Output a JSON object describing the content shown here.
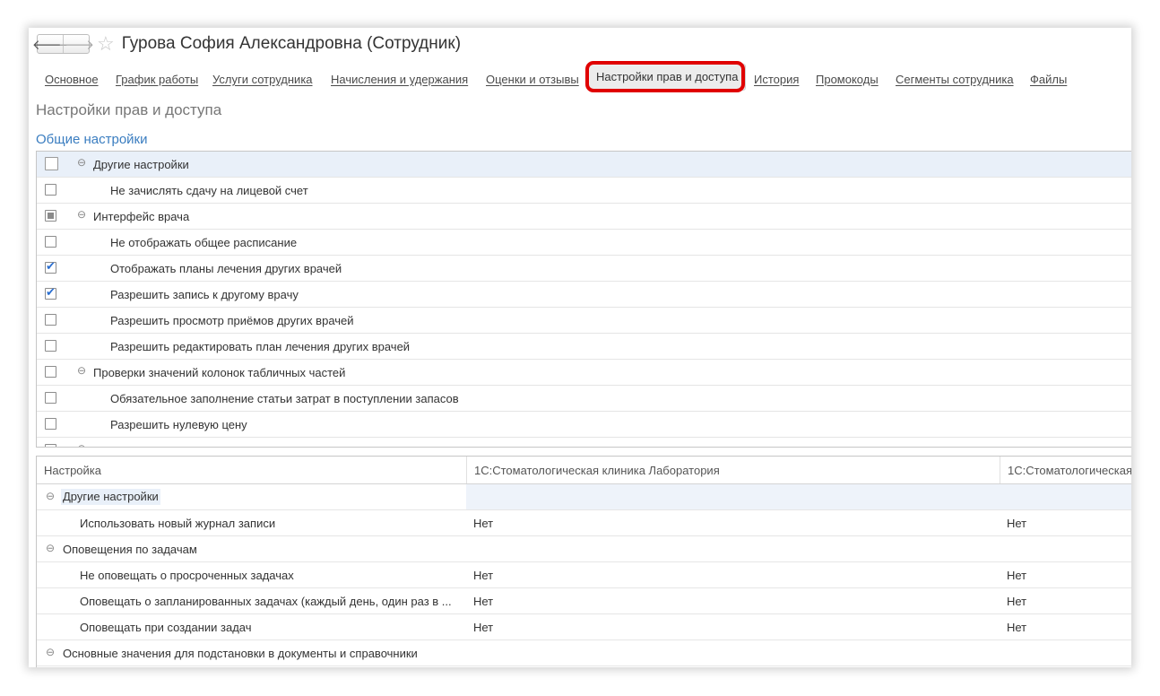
{
  "header": {
    "back_icon": "arrow-left-icon",
    "forward_icon": "arrow-right-icon",
    "favorite_icon": "star-outline-icon",
    "title": "Гурова София Александровна (Сотрудник)"
  },
  "tabs": [
    {
      "label": "Основное"
    },
    {
      "label": "График работы"
    },
    {
      "label": "Услуги сотрудника"
    },
    {
      "label": "Начисления и удержания"
    },
    {
      "label": "Оценки и отзывы"
    },
    {
      "label": "Настройки прав и доступа",
      "active": true
    },
    {
      "label": "История"
    },
    {
      "label": "Промокоды"
    },
    {
      "label": "Сегменты сотрудника"
    },
    {
      "label": "Файлы"
    }
  ],
  "highlight_color": "#e00000",
  "section_title": "Настройки прав и доступа",
  "group_title": "Общие настройки",
  "tree": [
    {
      "label": "Другие настройки",
      "level": 0,
      "state": "unchecked",
      "group": true,
      "selected": true
    },
    {
      "label": "Не зачислять сдачу на лицевой счет",
      "level": 1,
      "state": "unchecked"
    },
    {
      "label": "Интерфейс врача",
      "level": 0,
      "state": "partial",
      "group": true
    },
    {
      "label": "Не отображать общее расписание",
      "level": 1,
      "state": "unchecked"
    },
    {
      "label": "Отображать планы лечения других врачей",
      "level": 1,
      "state": "checked"
    },
    {
      "label": "Разрешить запись к другому врачу",
      "level": 1,
      "state": "checked"
    },
    {
      "label": "Разрешить просмотр приёмов других врачей",
      "level": 1,
      "state": "unchecked"
    },
    {
      "label": "Разрешить редактировать план лечения других врачей",
      "level": 1,
      "state": "unchecked"
    },
    {
      "label": "Проверки значений колонок табличных частей",
      "level": 0,
      "state": "unchecked",
      "group": true
    },
    {
      "label": "Обязательное заполнение статьи затрат в поступлении запасов",
      "level": 1,
      "state": "unchecked"
    },
    {
      "label": "Разрешить нулевую цену",
      "level": 1,
      "state": "unchecked"
    }
  ],
  "grid": {
    "columns": [
      "Настройка",
      "1С:Стоматологическая клиника Лаборатория",
      "1С:Стоматологическая"
    ],
    "rows": [
      {
        "label": "Другие настройки",
        "group": true,
        "selected": true,
        "v1": "",
        "v2": ""
      },
      {
        "label": "Использовать новый журнал записи",
        "v1": "Нет",
        "v2": "Нет"
      },
      {
        "label": "Оповещения по задачам",
        "group": true,
        "v1": "",
        "v2": ""
      },
      {
        "label": "Не оповещать о просроченных задачах",
        "v1": "Нет",
        "v2": "Нет"
      },
      {
        "label": "Оповещать о запланированных задачах (каждый день, один раз в ...",
        "v1": "Нет",
        "v2": "Нет"
      },
      {
        "label": "Оповещать при создании задач",
        "v1": "Нет",
        "v2": "Нет"
      },
      {
        "label": "Основные значения для подстановки в документы и справочники",
        "group": true,
        "v1": "",
        "v2": ""
      }
    ]
  }
}
